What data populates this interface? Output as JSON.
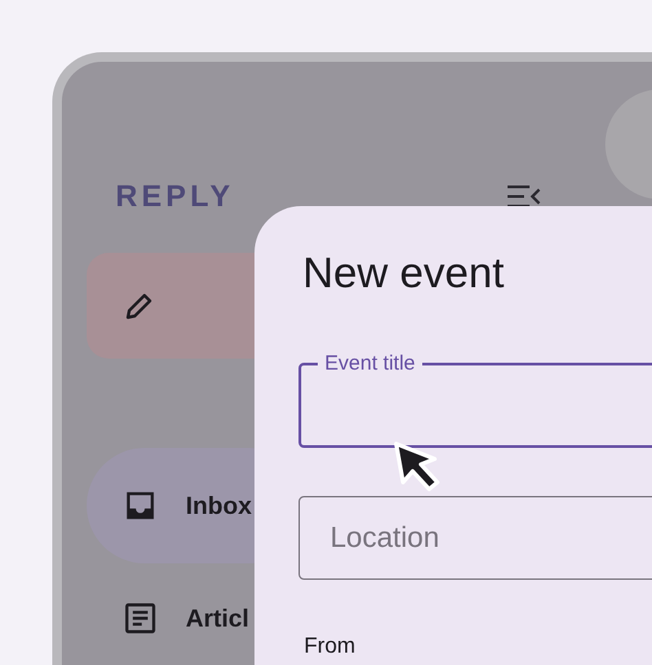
{
  "sidebar": {
    "brand": "REPLY",
    "items": [
      {
        "kind": "compose"
      },
      {
        "kind": "inbox",
        "label": "Inbox",
        "selected": true
      },
      {
        "kind": "articles",
        "label": "Articl",
        "selected": false
      }
    ]
  },
  "dialog": {
    "title": "New event",
    "fields": [
      {
        "label": "Event title",
        "focused": true
      },
      {
        "placeholder": "Location",
        "focused": false
      }
    ],
    "section": "From"
  }
}
